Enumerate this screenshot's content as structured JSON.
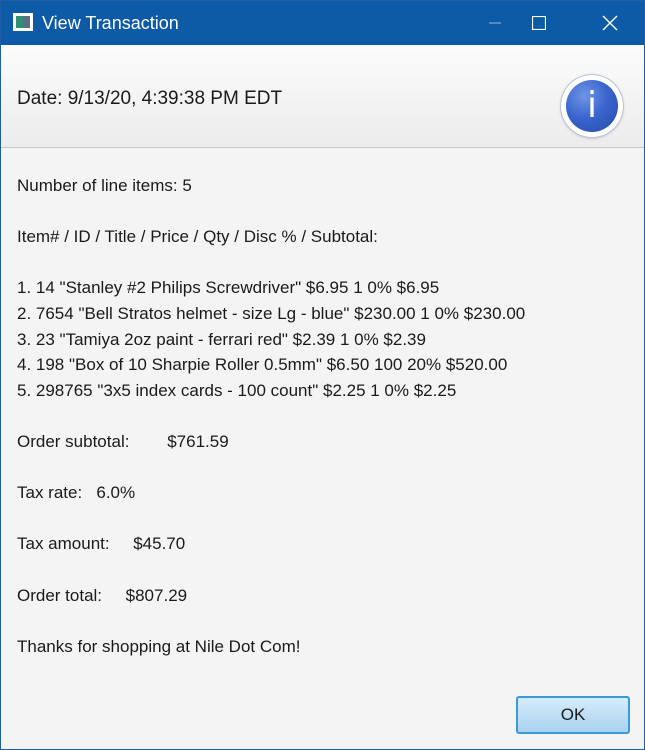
{
  "window": {
    "title": "View Transaction",
    "titlebar_color": "#0d5aa7"
  },
  "header": {
    "text": "Date: 9/13/20, 4:39:38 PM EDT",
    "icon": "info-icon",
    "icon_glyph": "i"
  },
  "body": {
    "line_count": "Number of line items: 5",
    "column_header": "Item# / ID / Title / Price / Qty / Disc % / Subtotal:",
    "items": [
      "1. 14 \"Stanley #2 Philips Screwdriver\" $6.95 1 0% $6.95",
      "2. 7654 \"Bell Stratos helmet - size Lg - blue\" $230.00 1 0% $230.00",
      "3. 23 \"Tamiya 2oz paint - ferrari red\" $2.39 1 0% $2.39",
      "4. 198 \"Box of 10 Sharpie Roller 0.5mm\" $6.50 100 20% $520.00",
      "5. 298765 \"3x5 index cards - 100 count\" $2.25 1 0% $2.25"
    ],
    "order_subtotal": "Order subtotal:        $761.59",
    "tax_rate": "Tax rate:   6.0%",
    "tax_amount": "Tax amount:     $45.70",
    "order_total": "Order total:     $807.29",
    "thanks": "Thanks for shopping at Nile Dot Com!"
  },
  "buttons": {
    "ok_label": "OK",
    "ok_accent": "#3b9ad9"
  }
}
